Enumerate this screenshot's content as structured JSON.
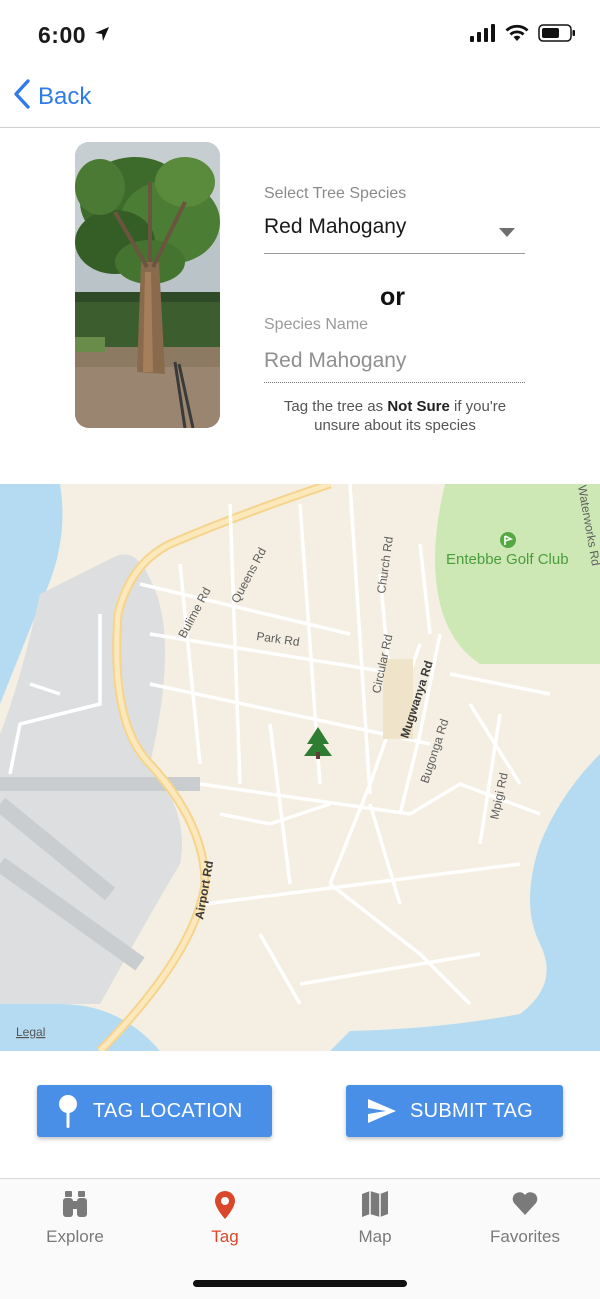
{
  "status_bar": {
    "time": "6:00"
  },
  "nav": {
    "back_label": "Back"
  },
  "species": {
    "select_label": "Select Tree Species",
    "selected": "Red Mahogany",
    "or_label": "or",
    "name_label": "Species Name",
    "name_value": "Red Mahogany",
    "hint_prefix": "Tag the tree as ",
    "hint_bold": "Not Sure",
    "hint_suffix": " if you're unsure about its species"
  },
  "map": {
    "legal": "Legal",
    "poi": "Entebbe Golf Club",
    "roads": [
      "Bulime Rd",
      "Queens Rd",
      "Park Rd",
      "Church Rd",
      "Circular Rd",
      "Mugwanya Rd",
      "Bugonga Rd",
      "Mpigi Rd",
      "Airport Rd",
      "Waterworks Rd"
    ]
  },
  "actions": {
    "tag_location": "TAG LOCATION",
    "submit_tag": "SUBMIT TAG"
  },
  "tabs": [
    {
      "label": "Explore"
    },
    {
      "label": "Tag"
    },
    {
      "label": "Map"
    },
    {
      "label": "Favorites"
    }
  ],
  "colors": {
    "accent": "#2f7ce8",
    "button": "#4a8fe7",
    "active_tab": "#d9482b",
    "tree_marker": "#2e7d32"
  }
}
